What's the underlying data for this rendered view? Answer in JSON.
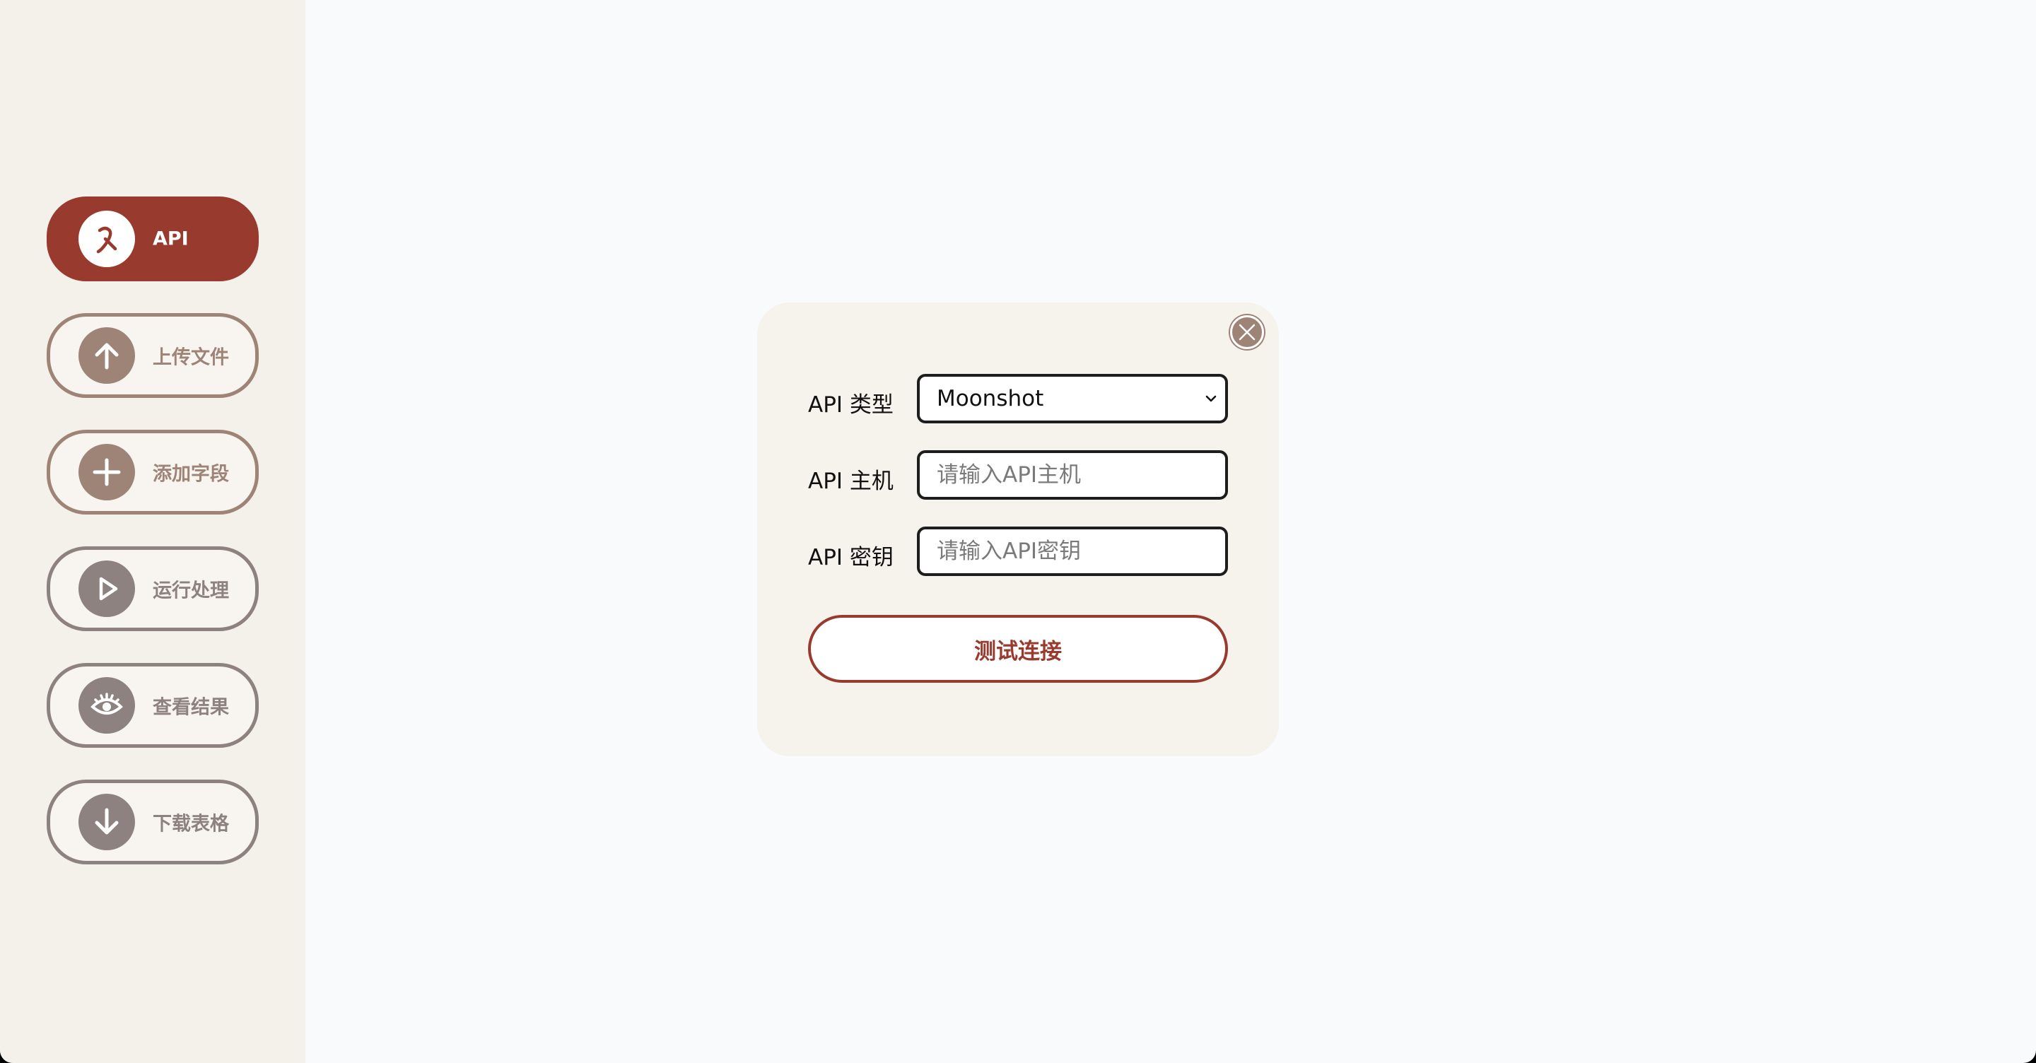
{
  "sidebar": {
    "items": [
      {
        "label": "API",
        "icon": "api-icon",
        "state": "active"
      },
      {
        "label": "上传文件",
        "icon": "arrow-up-icon",
        "state": "normal"
      },
      {
        "label": "添加字段",
        "icon": "plus-icon",
        "state": "normal"
      },
      {
        "label": "运行处理",
        "icon": "play-icon",
        "state": "disabled"
      },
      {
        "label": "查看结果",
        "icon": "eye-icon",
        "state": "disabled"
      },
      {
        "label": "下载表格",
        "icon": "arrow-down-icon",
        "state": "disabled"
      }
    ]
  },
  "dialog": {
    "api_type_label": "API 类型",
    "api_type_value": "Moonshot",
    "api_host_label": "API 主机",
    "api_host_placeholder": "请输入API主机",
    "api_key_label": "API 密钥",
    "api_key_placeholder": "请输入API密钥",
    "test_button_label": "测试连接"
  },
  "colors": {
    "accent": "#993a2e",
    "muted_brown": "#9e8377",
    "muted_grey": "#8e8280",
    "sidebar_bg": "#f4f1eb",
    "dialog_bg": "#f6f3ed",
    "page_bg": "#f9fafb"
  }
}
